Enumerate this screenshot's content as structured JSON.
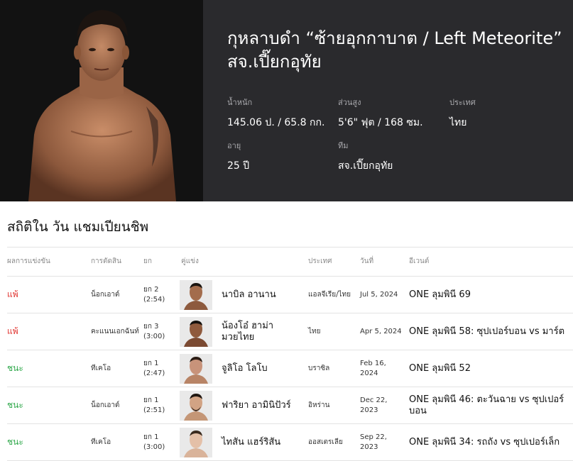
{
  "fighter": {
    "name_line1": "กุหลาบดำ “ซ้ายอุกกาบาต / Left Meteorite”",
    "name_line2": "สจ.เปี๊ยกอุทัย",
    "stats": {
      "weight_label": "น้ำหนัก",
      "weight_value": "145.06 ป. / 65.8 กก.",
      "height_label": "ส่วนสูง",
      "height_value": "5'6\" ฟุต / 168 ซม.",
      "country_label": "ประเทศ",
      "country_value": "ไทย",
      "age_label": "อายุ",
      "age_value": "25 ปี",
      "team_label": "ทีม",
      "team_value": "สจ.เปี๊ยกอุทัย"
    }
  },
  "record": {
    "title": "สถิติใน วัน แชมเปียนชิพ",
    "headers": {
      "result": "ผลการแข่งขัน",
      "method": "การตัดสิน",
      "round": "ยก",
      "opponent": "คู่แข่ง",
      "country": "ประเทศ",
      "date": "วันที่",
      "event": "อีเวนต์"
    },
    "rows": [
      {
        "result": "แพ้",
        "outcome": "loss",
        "method": "น็อกเอาต์",
        "round": "ยก 2",
        "time": "(2:54)",
        "opponent": "นาบิล อานาน",
        "country": "แอลจีเรีย/ไทย",
        "date": "Jul 5, 2024",
        "event": "ONE ลุมพินี 69"
      },
      {
        "result": "แพ้",
        "outcome": "loss",
        "method": "คะแนนเอกฉันท์",
        "round": "ยก 3",
        "time": "(3:00)",
        "opponent": "น้องโอ๋ ฮาม่ามวยไทย",
        "country": "ไทย",
        "date": "Apr 5, 2024",
        "event": "ONE ลุมพินี 58: ซุปเปอร์บอน vs มาร์ต"
      },
      {
        "result": "ชนะ",
        "outcome": "win",
        "method": "ทีเคโอ",
        "round": "ยก 1",
        "time": "(2:47)",
        "opponent": "จูลิโอ โลโบ",
        "country": "บราซิล",
        "date": "Feb 16, 2024",
        "event": "ONE ลุมพินี 52"
      },
      {
        "result": "ชนะ",
        "outcome": "win",
        "method": "น็อกเอาต์",
        "round": "ยก 1",
        "time": "(2:51)",
        "opponent": "ฟาริยา อามินิปัวร์",
        "country": "อิหร่าน",
        "date": "Dec 22, 2023",
        "event": "ONE ลุมพินี 46: ตะวันฉาย vs ซุปเปอร์บอน"
      },
      {
        "result": "ชนะ",
        "outcome": "win",
        "method": "ทีเคโอ",
        "round": "ยก 1",
        "time": "(3:00)",
        "opponent": "ไทสัน แฮร์ริสัน",
        "country": "ออสเตรเลีย",
        "date": "Sep 22, 2023",
        "event": "ONE ลุมพินี 34: รถถัง vs ซุปเปอร์เล็ก"
      }
    ]
  },
  "colors": {
    "win": "#2ea84a",
    "loss": "#e0332f",
    "hero_bg": "#2a2a2d"
  }
}
